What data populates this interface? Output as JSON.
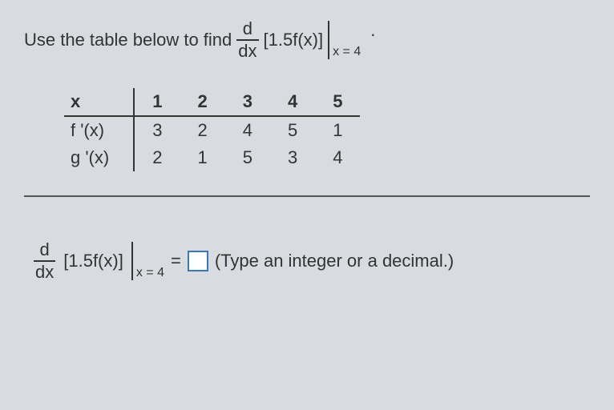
{
  "prompt": {
    "lead": "Use the table below to find",
    "d_top": "d",
    "d_bot": "dx",
    "bracket": "[1.5f(x)]",
    "eval_at": "x = 4"
  },
  "table": {
    "headers": [
      "x",
      "1",
      "2",
      "3",
      "4",
      "5"
    ],
    "rows": [
      {
        "label": "f '(x)",
        "cells": [
          "3",
          "2",
          "4",
          "5",
          "1"
        ]
      },
      {
        "label": "g '(x)",
        "cells": [
          "2",
          "1",
          "5",
          "3",
          "4"
        ]
      }
    ]
  },
  "chart_data": {
    "type": "table",
    "columns": [
      "x",
      "f '(x)",
      "g '(x)"
    ],
    "data": [
      {
        "x": 1,
        "f_prime": 3,
        "g_prime": 2
      },
      {
        "x": 2,
        "f_prime": 2,
        "g_prime": 1
      },
      {
        "x": 3,
        "f_prime": 4,
        "g_prime": 5
      },
      {
        "x": 4,
        "f_prime": 5,
        "g_prime": 3
      },
      {
        "x": 5,
        "f_prime": 1,
        "g_prime": 4
      }
    ]
  },
  "answer": {
    "d_top": "d",
    "d_bot": "dx",
    "bracket": "[1.5f(x)]",
    "eval_at": "x = 4",
    "equals": "=",
    "hint": "(Type an integer or a decimal.)"
  }
}
